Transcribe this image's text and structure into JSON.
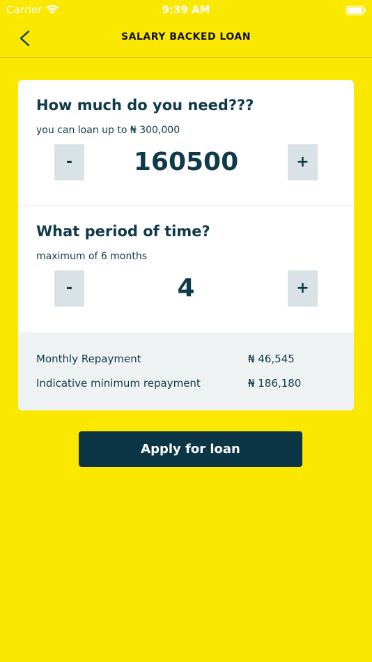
{
  "status_bar": {
    "carrier": "Carrier",
    "time": "9:39 AM"
  },
  "nav": {
    "title": "SALARY BACKED LOAN",
    "back_icon": "chevron-left-icon"
  },
  "amount_section": {
    "title": "How much do you need???",
    "subtitle": "you can loan up to ₦ 300,000",
    "minus_label": "-",
    "value": "160500",
    "plus_label": "+"
  },
  "period_section": {
    "title": "What period of time?",
    "subtitle": "maximum of 6 months",
    "minus_label": "-",
    "value": "4",
    "plus_label": "+"
  },
  "summary": {
    "monthly_label": "Monthly Repayment",
    "monthly_value": "₦ 46,545",
    "minimum_label": "Indicative minimum repayment",
    "minimum_value": "₦ 186,180"
  },
  "apply_label": "Apply for loan",
  "colors": {
    "background": "#FBE800",
    "primary": "#0C3545",
    "stepper": "#D9E3E7",
    "summary_bg": "#EEF2F3"
  }
}
